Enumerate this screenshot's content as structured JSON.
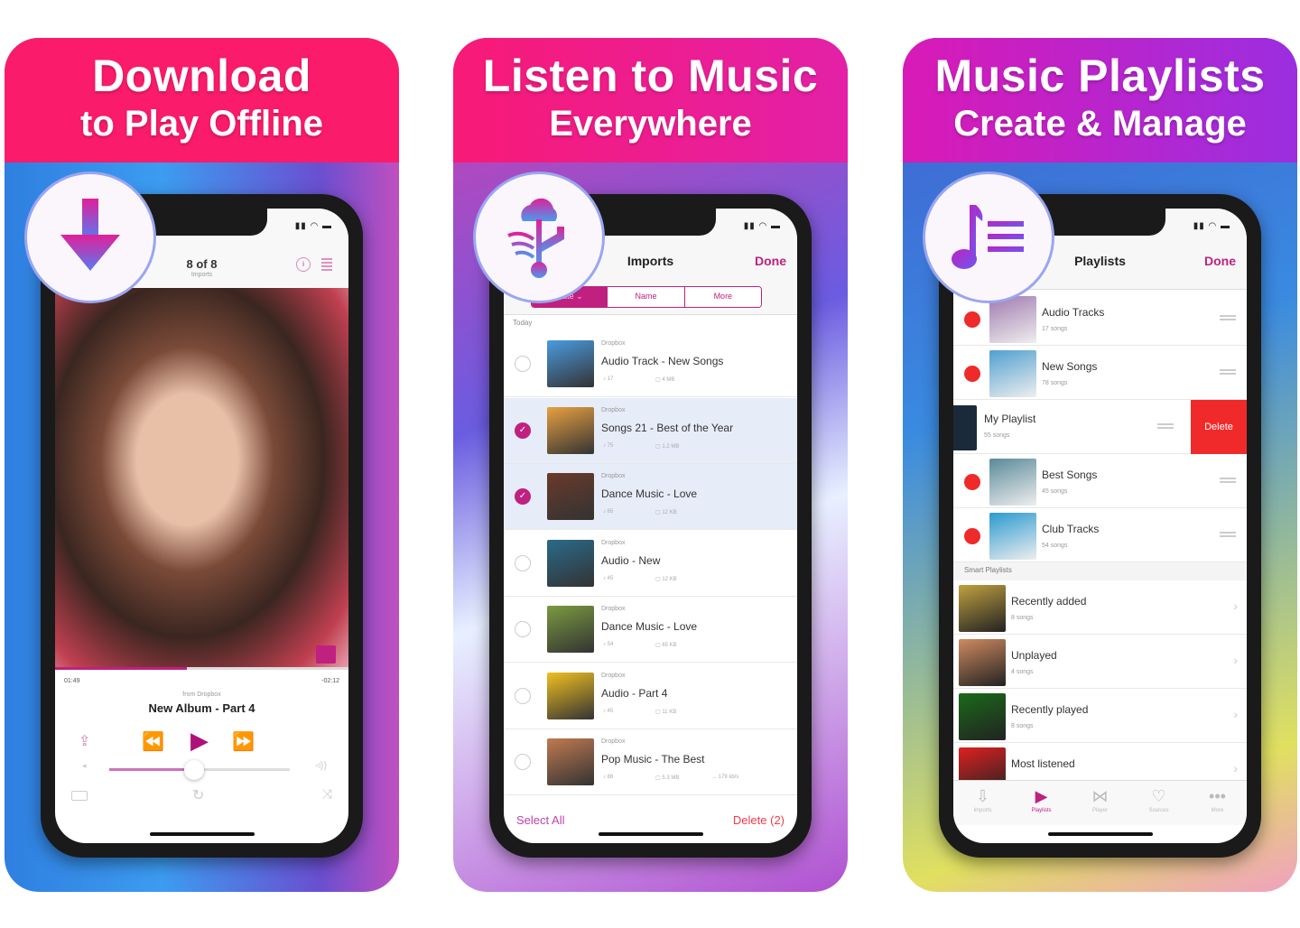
{
  "colors": {
    "accent": "#c0207f",
    "delete": "#f02a2a",
    "pink": "#fb1b6b",
    "purple": "#9b2ee0"
  },
  "panels": [
    {
      "title": "Download",
      "subtitle": "to Play Offline",
      "badge_icon": "download-arrow-icon"
    },
    {
      "title": "Listen to Music",
      "subtitle": "Everywhere",
      "badge_icon": "cloud-usb-icon"
    },
    {
      "title": "Music Playlists",
      "subtitle": "Create & Manage",
      "badge_icon": "music-list-icon"
    }
  ],
  "player": {
    "nav_title": "8 of 8",
    "nav_subtitle": "Imports",
    "elapsed": "01:49",
    "remaining": "-02:12",
    "source": "from Dropbox",
    "track": "New Album - Part 4",
    "progress": 0.45,
    "volume": 0.47
  },
  "imports": {
    "title": "Imports",
    "done": "Done",
    "segments": [
      "Date",
      "Name",
      "More"
    ],
    "section": "Today",
    "select_all": "Select All",
    "delete": "Delete (2)",
    "items": [
      {
        "source": "Dropbox",
        "title": "Audio Track - New Songs",
        "count": "17",
        "size": "4 MB",
        "extra": "",
        "selected": false,
        "color": "#4a9be0"
      },
      {
        "source": "Dropbox",
        "title": "Songs 21 - Best of the Year",
        "count": "75",
        "size": "1.2 MB",
        "extra": "",
        "selected": true,
        "color": "#e8a040"
      },
      {
        "source": "Dropbox",
        "title": "Dance Music - Love",
        "count": "65",
        "size": "12 KB",
        "extra": "",
        "selected": true,
        "color": "#6a3a2a"
      },
      {
        "source": "Dropbox",
        "title": "Audio - New",
        "count": "45",
        "size": "12 KB",
        "extra": "",
        "selected": false,
        "color": "#2a6a8a"
      },
      {
        "source": "Dropbox",
        "title": "Dance Music - Love",
        "count": "54",
        "size": "65 KB",
        "extra": "",
        "selected": false,
        "color": "#7a9a40"
      },
      {
        "source": "Dropbox",
        "title": "Audio - Part 4",
        "count": "45",
        "size": "11 KB",
        "extra": "",
        "selected": false,
        "color": "#f0c020"
      },
      {
        "source": "Dropbox",
        "title": "Pop Music - The Best",
        "count": "88",
        "size": "5.3 MB",
        "extra": "179 kb/s",
        "selected": false,
        "color": "#c07a50"
      }
    ]
  },
  "playlists": {
    "title": "Playlists",
    "done": "Done",
    "delete_label": "Delete",
    "section": "Smart Playlists",
    "items": [
      {
        "title": "Audio Tracks",
        "songs": "17 songs",
        "color": "#a07ab0"
      },
      {
        "title": "New Songs",
        "songs": "78 songs",
        "color": "#50a0d0"
      },
      {
        "title": "My Playlist",
        "songs": "55 songs",
        "color": "#1a2a3a",
        "swiped": true
      },
      {
        "title": "Best Songs",
        "songs": "45 songs",
        "color": "#5a8a9a"
      },
      {
        "title": "Club Tracks",
        "songs": "54 songs",
        "color": "#2a9ad0"
      }
    ],
    "smart": [
      {
        "title": "Recently added",
        "songs": "8 songs",
        "color": "#c0a040"
      },
      {
        "title": "Unplayed",
        "songs": "4 songs",
        "color": "#d08a60"
      },
      {
        "title": "Recently played",
        "songs": "8 songs",
        "color": "#1a6a1a"
      },
      {
        "title": "Most listened",
        "songs": "",
        "color": "#e02020"
      }
    ],
    "tabs": [
      {
        "label": "Imports",
        "icon": "download-tray-icon",
        "active": false
      },
      {
        "label": "Playlists",
        "icon": "playlist-icon",
        "active": true
      },
      {
        "label": "Player",
        "icon": "player-icon",
        "active": false
      },
      {
        "label": "Sources",
        "icon": "heart-icon",
        "active": false
      },
      {
        "label": "More",
        "icon": "more-icon",
        "active": false
      }
    ]
  }
}
